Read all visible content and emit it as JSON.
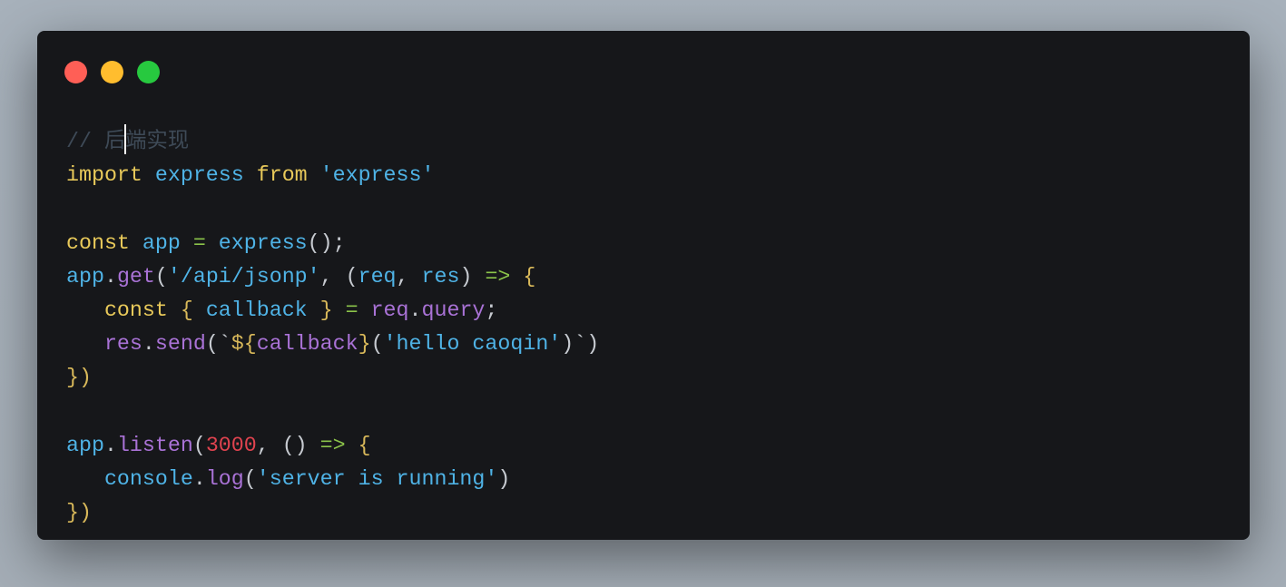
{
  "window": {
    "controls": [
      {
        "name": "close",
        "color": "#ff5f56"
      },
      {
        "name": "minimize",
        "color": "#ffbd2e"
      },
      {
        "name": "maximize",
        "color": "#27c93f"
      }
    ]
  },
  "code": {
    "language": "javascript",
    "lines": [
      [
        [
          "// 后",
          "comment"
        ],
        [
          "|",
          "cursor"
        ],
        [
          "端实现",
          "comment"
        ]
      ],
      [
        [
          "import",
          "keyword"
        ],
        [
          " ",
          "punct"
        ],
        [
          "express",
          "ident"
        ],
        [
          " ",
          "punct"
        ],
        [
          "from",
          "keyword"
        ],
        [
          " ",
          "punct"
        ],
        [
          "'express'",
          "string"
        ]
      ],
      [],
      [
        [
          "const",
          "keyword"
        ],
        [
          " ",
          "punct"
        ],
        [
          "app",
          "ident"
        ],
        [
          " ",
          "punct"
        ],
        [
          "=",
          "operator"
        ],
        [
          " ",
          "punct"
        ],
        [
          "express",
          "ident"
        ],
        [
          "();",
          "punct"
        ]
      ],
      [
        [
          "app",
          "ident"
        ],
        [
          ".",
          "punct"
        ],
        [
          "get",
          "func"
        ],
        [
          "(",
          "punct"
        ],
        [
          "'/api/jsonp'",
          "string"
        ],
        [
          ", (",
          "punct"
        ],
        [
          "req",
          "ident"
        ],
        [
          ", ",
          "punct"
        ],
        [
          "res",
          "ident"
        ],
        [
          ") ",
          "punct"
        ],
        [
          "=>",
          "operator"
        ],
        [
          " ",
          "punct"
        ],
        [
          "{",
          "brace"
        ]
      ],
      [
        [
          "   ",
          "punct"
        ],
        [
          "const",
          "keyword"
        ],
        [
          " ",
          "punct"
        ],
        [
          "{",
          "brace"
        ],
        [
          " ",
          "punct"
        ],
        [
          "callback",
          "ident"
        ],
        [
          " ",
          "punct"
        ],
        [
          "}",
          "brace"
        ],
        [
          " ",
          "punct"
        ],
        [
          "=",
          "operator"
        ],
        [
          " ",
          "punct"
        ],
        [
          "req",
          "func"
        ],
        [
          ".",
          "punct"
        ],
        [
          "query",
          "func"
        ],
        [
          ";",
          "punct"
        ]
      ],
      [
        [
          "   ",
          "punct"
        ],
        [
          "res",
          "func"
        ],
        [
          ".",
          "punct"
        ],
        [
          "send",
          "func"
        ],
        [
          "(`",
          "punct"
        ],
        [
          "${",
          "brace"
        ],
        [
          "callback",
          "func"
        ],
        [
          "}",
          "brace"
        ],
        [
          "(",
          "punct"
        ],
        [
          "'hello caoqin'",
          "string"
        ],
        [
          ")`)",
          "punct"
        ]
      ],
      [
        [
          "})",
          "brace"
        ]
      ],
      [],
      [
        [
          "app",
          "ident"
        ],
        [
          ".",
          "punct"
        ],
        [
          "listen",
          "func"
        ],
        [
          "(",
          "punct"
        ],
        [
          "3000",
          "number"
        ],
        [
          ", () ",
          "punct"
        ],
        [
          "=>",
          "operator"
        ],
        [
          " ",
          "punct"
        ],
        [
          "{",
          "brace"
        ]
      ],
      [
        [
          "   ",
          "punct"
        ],
        [
          "console",
          "ident"
        ],
        [
          ".",
          "punct"
        ],
        [
          "log",
          "func"
        ],
        [
          "(",
          "punct"
        ],
        [
          "'server is running'",
          "string"
        ],
        [
          ")",
          "punct"
        ]
      ],
      [
        [
          "})",
          "brace"
        ]
      ]
    ]
  }
}
